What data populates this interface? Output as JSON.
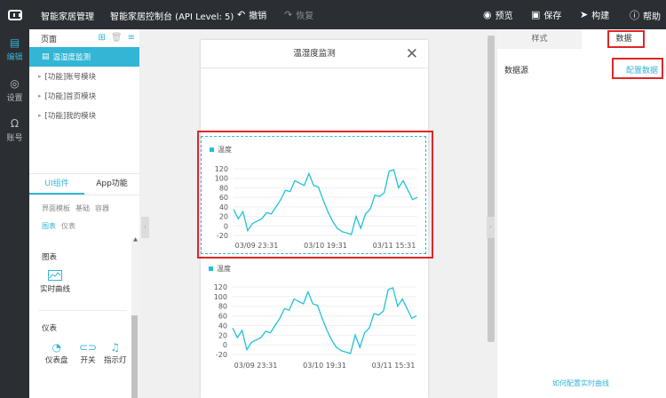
{
  "topbar": {
    "app_name": "智能家居管理",
    "project_title": "智能家居控制台 (API Level: 5)",
    "undo": "撤销",
    "redo": "恢复",
    "preview": "预览",
    "save": "保存",
    "build": "构建",
    "help": "帮助"
  },
  "rail": {
    "edit": "编辑",
    "settings": "设置",
    "account": "账号"
  },
  "pages_panel": {
    "title": "页面",
    "items": [
      "温湿度监测",
      "[功能]账号模块",
      "[功能]首页模块",
      "[功能]我的模块"
    ]
  },
  "components_panel": {
    "tabs": [
      "UI组件",
      "App功能"
    ],
    "sub_tabs_row1": [
      "界面模板",
      "基础",
      "容器"
    ],
    "sub_tabs_row2": [
      "图表",
      "仪表"
    ],
    "section_chart": "图表",
    "realtime_curve": "实时曲线",
    "section_gauge": "仪表",
    "gauge_items": [
      "仪表盘",
      "开关",
      "指示灯"
    ]
  },
  "phone": {
    "title": "温湿度监测"
  },
  "chart_data": [
    {
      "type": "line",
      "series": [
        {
          "name": "温度",
          "values": [
            35,
            15,
            30,
            -10,
            5,
            10,
            15,
            28,
            25,
            40,
            55,
            75,
            72,
            95,
            90,
            85,
            110,
            85,
            82,
            55,
            30,
            10,
            -5,
            -12,
            -15,
            -18,
            20,
            -5,
            25,
            35,
            65,
            62,
            70,
            115,
            118,
            80,
            95,
            75,
            55,
            60
          ]
        }
      ],
      "x_tick_labels": [
        "03/09 23:31",
        "03/10 19:31",
        "03/11 15:31"
      ],
      "y_ticks": [
        120,
        100,
        80,
        60,
        40,
        20,
        0,
        -20
      ],
      "ylim": [
        -20,
        120
      ],
      "color": "#1fc3d6",
      "grid": true,
      "legend": "top-left"
    },
    {
      "type": "line",
      "series": [
        {
          "name": "温度",
          "values": [
            35,
            15,
            30,
            -10,
            5,
            10,
            15,
            28,
            25,
            40,
            55,
            75,
            72,
            95,
            90,
            85,
            110,
            85,
            82,
            55,
            30,
            10,
            -5,
            -12,
            -15,
            -18,
            20,
            -5,
            25,
            35,
            65,
            62,
            70,
            115,
            118,
            80,
            95,
            75,
            55,
            60
          ]
        }
      ],
      "x_tick_labels": [
        "03/09 23:31",
        "03/10 19:31",
        "03/11 15:31"
      ],
      "y_ticks": [
        120,
        100,
        80,
        60,
        40,
        20,
        0,
        -20
      ],
      "ylim": [
        -20,
        120
      ],
      "color": "#1fc3d6",
      "grid": true,
      "legend": "top-left"
    }
  ],
  "right_panel": {
    "tabs": [
      "样式",
      "数据"
    ],
    "datasource_label": "数据源",
    "configure_link": "配置数据",
    "help_link": "如何配置实时曲线"
  }
}
